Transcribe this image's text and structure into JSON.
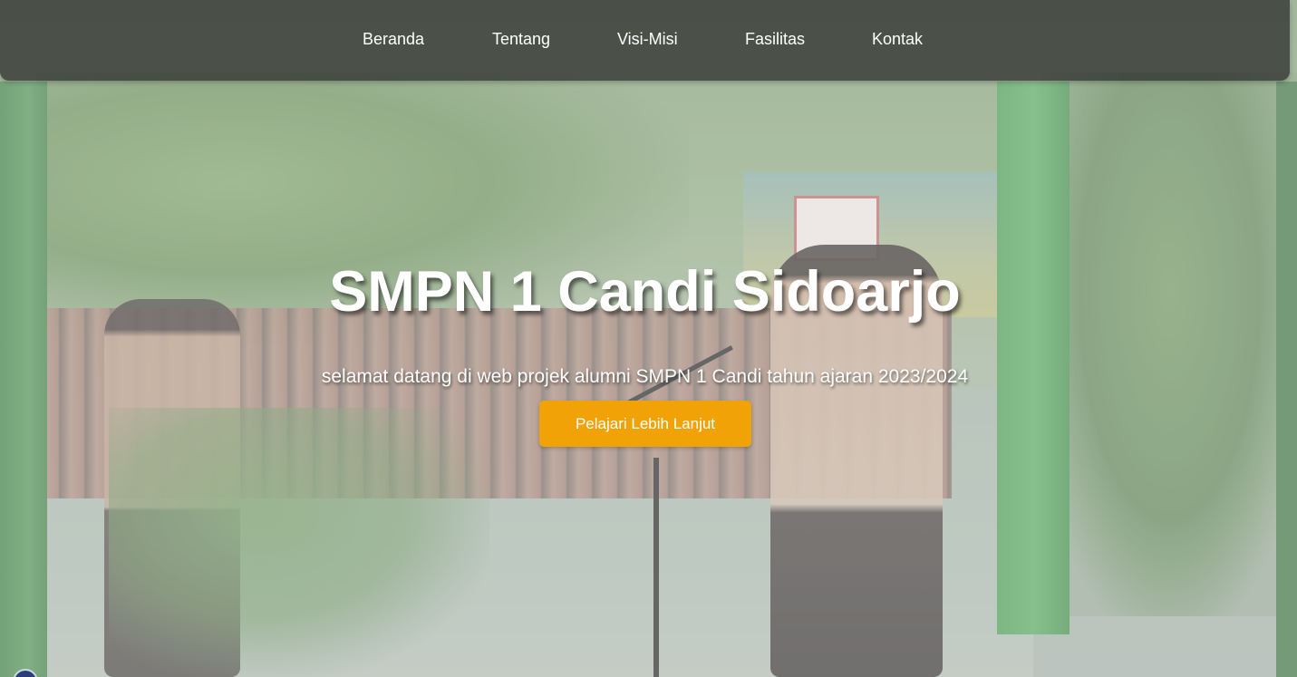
{
  "navbar": {
    "items": [
      {
        "label": "Beranda"
      },
      {
        "label": "Tentang"
      },
      {
        "label": "Visi-Misi"
      },
      {
        "label": "Fasilitas"
      },
      {
        "label": "Kontak"
      }
    ]
  },
  "hero": {
    "title": "SMPN 1 Candi Sidoarjo",
    "subtitle": "selamat datang di web projek alumni SMPN 1 Candi tahun ajaran 2023/2024",
    "cta_label": "Pelajari Lebih Lanjut"
  },
  "colors": {
    "navbar_bg": "#282828",
    "cta_bg": "#f0a207",
    "text": "#ffffff"
  }
}
